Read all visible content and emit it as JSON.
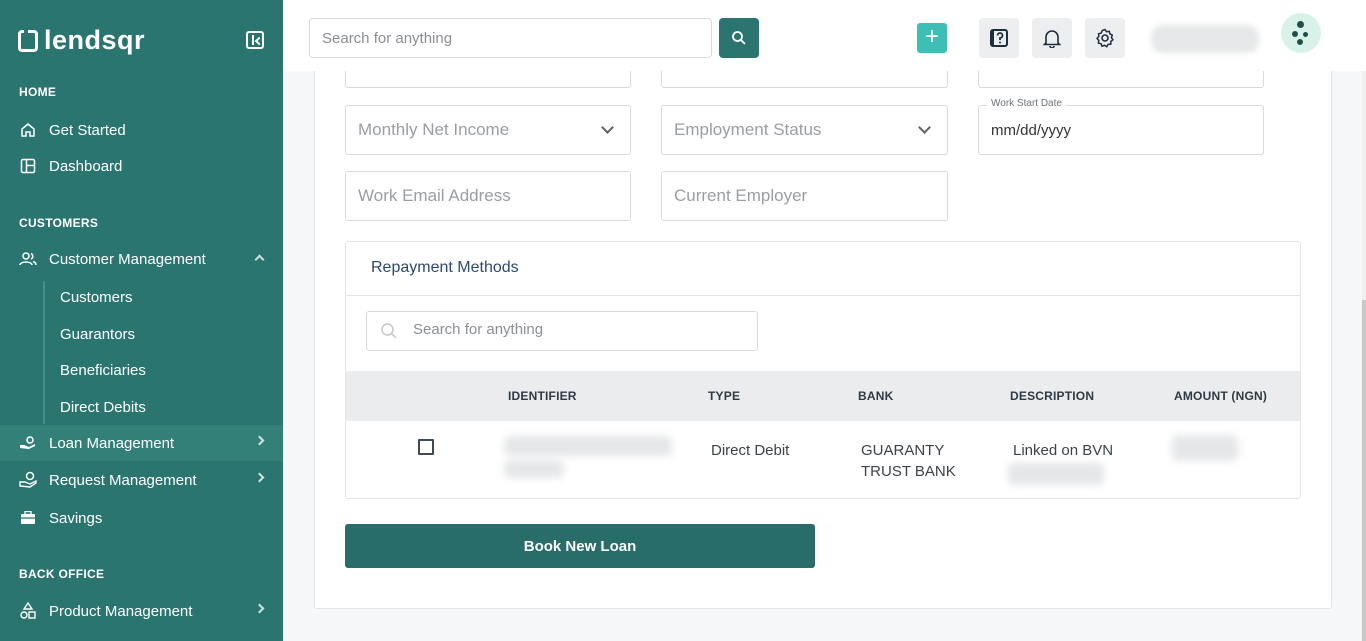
{
  "brand": {
    "name": "lendsqr"
  },
  "sidebar": {
    "sections": {
      "home": "HOME",
      "customers": "CUSTOMERS",
      "back_office": "BACK OFFICE"
    },
    "items": {
      "get_started": "Get Started",
      "dashboard": "Dashboard",
      "customer_management": "Customer Management",
      "loan_management": "Loan Management",
      "request_management": "Request Management",
      "savings": "Savings",
      "product_management": "Product Management"
    },
    "sub_items": {
      "customers": "Customers",
      "guarantors": "Guarantors",
      "beneficiaries": "Beneficiaries",
      "direct_debits": "Direct Debits"
    }
  },
  "topbar": {
    "search_placeholder": "Search for anything",
    "plus_label": "+"
  },
  "form": {
    "monthly_net_income": "Monthly Net Income",
    "employment_status": "Employment Status",
    "work_start_date_label": "Work Start Date",
    "work_start_date_value": "mm/dd/yyyy",
    "work_email": "Work Email Address",
    "current_employer": "Current Employer"
  },
  "repayment": {
    "title": "Repayment Methods",
    "search_placeholder": "Search for anything",
    "columns": {
      "identifier": "IDENTIFIER",
      "type": "TYPE",
      "bank": "BANK",
      "description": "DESCRIPTION",
      "amount": "AMOUNT (NGN)"
    },
    "row": {
      "type": "Direct Debit",
      "bank_line1": "GUARANTY",
      "bank_line2": "TRUST BANK",
      "description": "Linked on BVN"
    }
  },
  "actions": {
    "book_new_loan": "Book New Loan"
  },
  "colors": {
    "sidebar": "#2a7570",
    "accent": "#3dbfb5",
    "button": "#286d69"
  }
}
